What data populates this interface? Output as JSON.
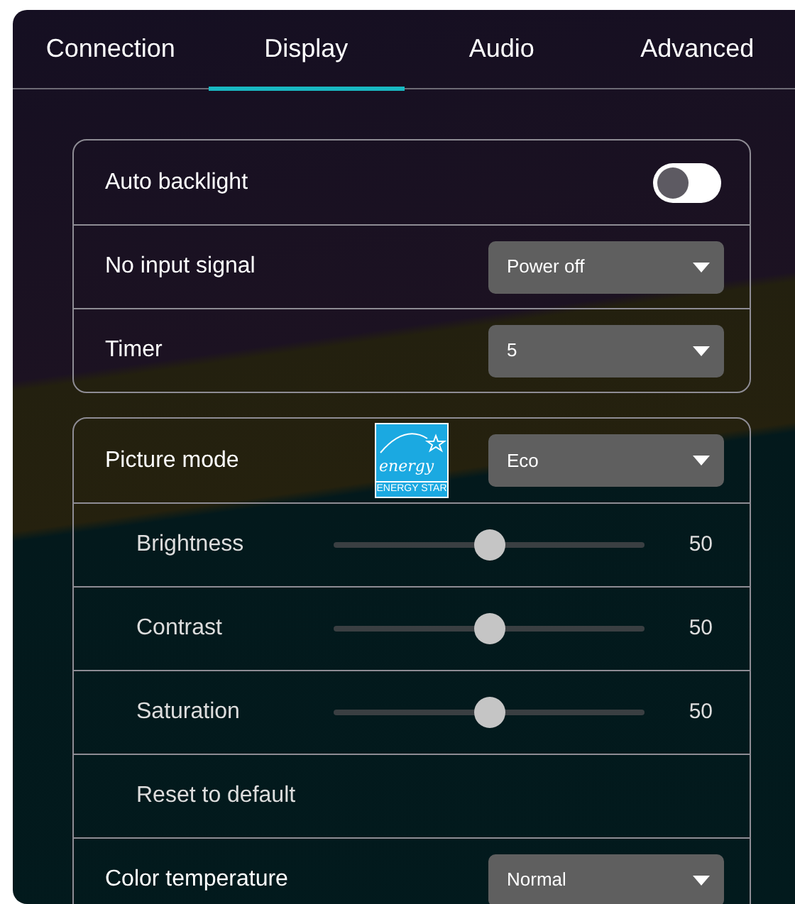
{
  "tabs": [
    {
      "label": "Connection",
      "selected": false
    },
    {
      "label": "Display",
      "selected": true
    },
    {
      "label": "Audio",
      "selected": false
    },
    {
      "label": "Advanced",
      "selected": false
    }
  ],
  "groups": [
    {
      "rows": [
        {
          "kind": "toggle",
          "label": "Auto backlight",
          "on": false
        },
        {
          "kind": "select",
          "label": "No input signal",
          "value": "Power off"
        },
        {
          "kind": "select",
          "label": "Timer",
          "value": "5"
        }
      ]
    },
    {
      "rows": [
        {
          "kind": "select",
          "label": "Picture mode",
          "value": "Eco",
          "badge": {
            "script": "energy",
            "caption": "ENERGY STAR"
          }
        },
        {
          "kind": "slider",
          "label": "Brightness",
          "level": 0.5,
          "reading": "50"
        },
        {
          "kind": "slider",
          "label": "Contrast",
          "level": 0.5,
          "reading": "50"
        },
        {
          "kind": "slider",
          "label": "Saturation",
          "level": 0.5,
          "reading": "50"
        },
        {
          "kind": "action",
          "label": "Reset to default"
        },
        {
          "kind": "select",
          "label": "Color temperature",
          "value": "Normal"
        }
      ]
    }
  ]
}
